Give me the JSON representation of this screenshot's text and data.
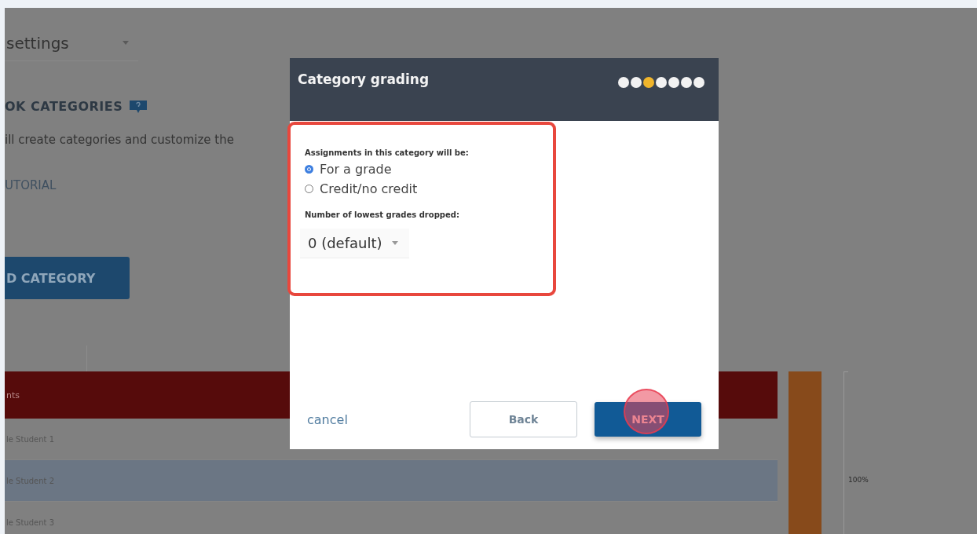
{
  "page": {
    "settings_select": "settings",
    "section_title": "OK CATEGORIES",
    "description": "ill create categories and customize the",
    "tutorial_link": "UTORIAL",
    "add_button": "D CATEGORY",
    "table": {
      "header": "nts",
      "rows": [
        {
          "name": "le Student 1",
          "selected": false
        },
        {
          "name": "le Student 2",
          "selected": true
        },
        {
          "name": "le Student 3",
          "selected": false
        }
      ]
    },
    "chart_label": "100%"
  },
  "dialog": {
    "title": "Category grading",
    "steps": [
      {
        "selected": false
      },
      {
        "selected": false
      },
      {
        "selected": true
      },
      {
        "selected": false
      },
      {
        "selected": false
      },
      {
        "selected": false
      },
      {
        "selected": false
      }
    ],
    "question": "Assignments in this category will be:",
    "options": [
      {
        "label": "For a grade",
        "selected": true
      },
      {
        "label": "Credit/no credit",
        "selected": false
      }
    ],
    "drop_label": "Number of lowest grades dropped:",
    "drop_select": "0 (default)",
    "cancel": "cancel",
    "back": "Back",
    "next": "NEXT"
  }
}
